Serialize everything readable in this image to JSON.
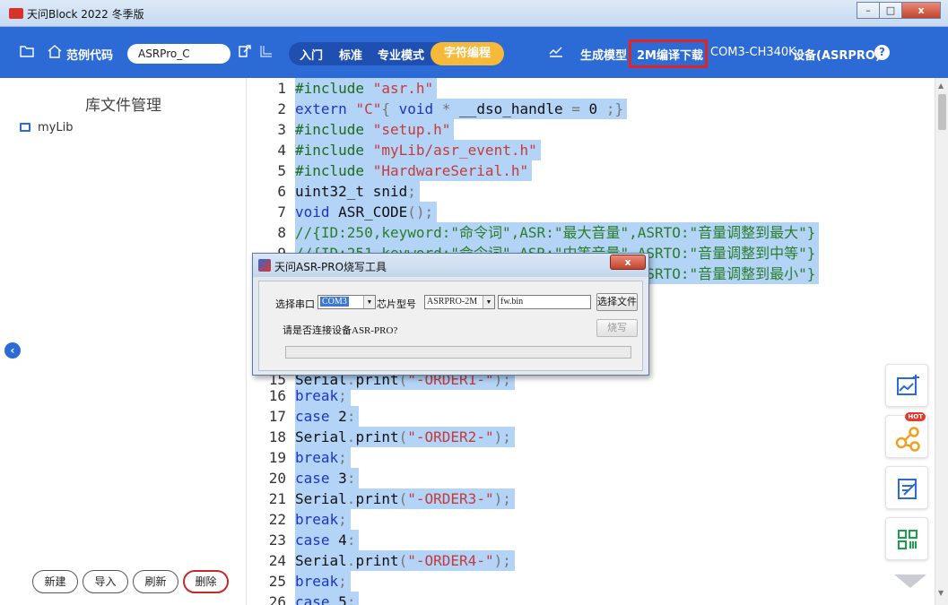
{
  "window": {
    "title": "天问Block 2022 冬季版",
    "btn_min": "–",
    "btn_max": "□",
    "btn_close": "x"
  },
  "toolbar": {
    "sample_code": "范例代码",
    "project_name": "ASRPro_C",
    "modes": [
      "入门",
      "标准",
      "专业模式",
      "字符编程"
    ],
    "generate_model": "生成模型",
    "compile_download": "2M编译下载",
    "port": "COM3-CH340K",
    "device": "设备(ASRPRO)",
    "help": "?"
  },
  "left_panel": {
    "title": "库文件管理",
    "items": [
      "myLib"
    ],
    "buttons": {
      "new": "新建",
      "import": "导入",
      "refresh": "刷新",
      "delete": "删除"
    }
  },
  "editor": {
    "visible_lines": [
      {
        "n": "1",
        "tokens": [
          [
            "pp",
            "#include "
          ],
          [
            "str",
            "\"asr.h\""
          ]
        ]
      },
      {
        "n": "2",
        "tokens": [
          [
            "kw",
            "extern "
          ],
          [
            "str",
            "\"C\""
          ],
          [
            "op",
            "{ "
          ],
          [
            "kw",
            "void "
          ],
          [
            "op",
            "* "
          ],
          [
            "id",
            "__dso_handle "
          ],
          [
            "op",
            "= "
          ],
          [
            "id",
            "0 "
          ],
          [
            "op",
            ";}"
          ]
        ]
      },
      {
        "n": "3",
        "tokens": [
          [
            "pp",
            "#include "
          ],
          [
            "str",
            "\"setup.h\""
          ]
        ]
      },
      {
        "n": "4",
        "tokens": [
          [
            "pp",
            "#include "
          ],
          [
            "str",
            "\"myLib/asr_event.h\""
          ]
        ]
      },
      {
        "n": "5",
        "tokens": [
          [
            "pp",
            "#include "
          ],
          [
            "str",
            "\"HardwareSerial.h\""
          ]
        ]
      },
      {
        "n": "6",
        "tokens": [
          [
            "id",
            "uint32_t snid"
          ],
          [
            "op",
            ";"
          ]
        ]
      },
      {
        "n": "7",
        "tokens": [
          [
            "kw",
            "void "
          ],
          [
            "id",
            "ASR_CODE"
          ],
          [
            "op",
            "();"
          ]
        ]
      },
      {
        "n": "8",
        "tokens": [
          [
            "cm",
            "//{ID:250,keyword:\"命令词\",ASR:\"最大音量\",ASRTO:\"音量调整到最大\"}"
          ]
        ]
      },
      {
        "n": "9",
        "tokens": [
          [
            "cm",
            "//{ID:251,keyword:\"命令词\",ASR:\"中等音量\",ASRTO:\"音量调整到中等\"}"
          ]
        ]
      },
      {
        "n": "10",
        "tokens": [
          [
            "cm",
            "//{ID:252,keyword:\"命令词\",ASR:\"最小音量\",ASRTO:\"音量调整到最小\"}"
          ]
        ]
      },
      {
        "n": "15",
        "tokens": [
          [
            "id",
            "Serial"
          ],
          [
            "op",
            "."
          ],
          [
            "id",
            "print"
          ],
          [
            "op",
            "("
          ],
          [
            "str",
            "\"-ORDER1-\""
          ],
          [
            "op",
            ");"
          ]
        ]
      },
      {
        "n": "16",
        "tokens": [
          [
            "kw",
            "break"
          ],
          [
            "op",
            ";"
          ]
        ]
      },
      {
        "n": "17",
        "tokens": [
          [
            "kw",
            "case "
          ],
          [
            "id",
            "2"
          ],
          [
            "op",
            ":"
          ]
        ]
      },
      {
        "n": "18",
        "tokens": [
          [
            "id",
            "Serial"
          ],
          [
            "op",
            "."
          ],
          [
            "id",
            "print"
          ],
          [
            "op",
            "("
          ],
          [
            "str",
            "\"-ORDER2-\""
          ],
          [
            "op",
            ");"
          ]
        ]
      },
      {
        "n": "19",
        "tokens": [
          [
            "kw",
            "break"
          ],
          [
            "op",
            ";"
          ]
        ]
      },
      {
        "n": "20",
        "tokens": [
          [
            "kw",
            "case "
          ],
          [
            "id",
            "3"
          ],
          [
            "op",
            ":"
          ]
        ]
      },
      {
        "n": "21",
        "tokens": [
          [
            "id",
            "Serial"
          ],
          [
            "op",
            "."
          ],
          [
            "id",
            "print"
          ],
          [
            "op",
            "("
          ],
          [
            "str",
            "\"-ORDER3-\""
          ],
          [
            "op",
            ");"
          ]
        ]
      },
      {
        "n": "22",
        "tokens": [
          [
            "kw",
            "break"
          ],
          [
            "op",
            ";"
          ]
        ]
      },
      {
        "n": "23",
        "tokens": [
          [
            "kw",
            "case "
          ],
          [
            "id",
            "4"
          ],
          [
            "op",
            ":"
          ]
        ]
      },
      {
        "n": "24",
        "tokens": [
          [
            "id",
            "Serial"
          ],
          [
            "op",
            "."
          ],
          [
            "id",
            "print"
          ],
          [
            "op",
            "("
          ],
          [
            "str",
            "\"-ORDER4-\""
          ],
          [
            "op",
            ");"
          ]
        ]
      },
      {
        "n": "25",
        "tokens": [
          [
            "kw",
            "break"
          ],
          [
            "op",
            ";"
          ]
        ]
      },
      {
        "n": "26",
        "tokens": [
          [
            "kw",
            "case "
          ],
          [
            "id",
            "5"
          ],
          [
            "op",
            ":"
          ]
        ]
      }
    ]
  },
  "float_tools": {
    "hot_badge": "HOT",
    "items": [
      "chart-edit-icon",
      "share-icon",
      "note-icon",
      "qrcode-icon"
    ]
  },
  "dialog": {
    "title": "天问ASR-PRO烧写工具",
    "close": "x",
    "port_label": "选择串口",
    "port_value": "COM3",
    "chip_label": "芯片型号",
    "chip_value": "ASRPRO-2M",
    "file_value": "fw.bin",
    "choose_file": "选择文件",
    "status": "请是否连接设备ASR-PRO?",
    "burn": "烧写",
    "progress": 0
  },
  "colors": {
    "toolbar": "#2c6ad6",
    "mode_active": "#f6b93a",
    "highlight_box": "#e32222",
    "selection": "#b3d4f7"
  }
}
